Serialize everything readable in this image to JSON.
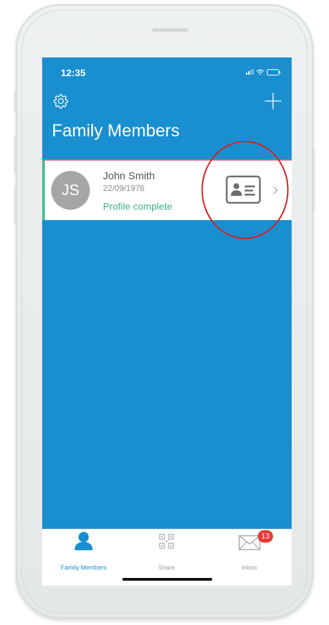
{
  "status_bar": {
    "time": "12:35"
  },
  "header": {
    "title": "Family Members"
  },
  "members": [
    {
      "initials": "JS",
      "name": "John Smith",
      "dob": "22/09/1976",
      "status": "Profile complete"
    }
  ],
  "tabs": [
    {
      "label": "Family Members",
      "icon": "person-icon",
      "active": true
    },
    {
      "label": "Share",
      "icon": "qr-code-icon",
      "active": false
    },
    {
      "label": "Inbox",
      "icon": "envelope-icon",
      "active": false,
      "badge": "13"
    }
  ],
  "colors": {
    "primary": "#1a8fd0",
    "profile_status": "#3bb48a",
    "card_top_border": "#e05c8a",
    "annotation_ring": "#d81f1f",
    "badge": "#e53935"
  }
}
